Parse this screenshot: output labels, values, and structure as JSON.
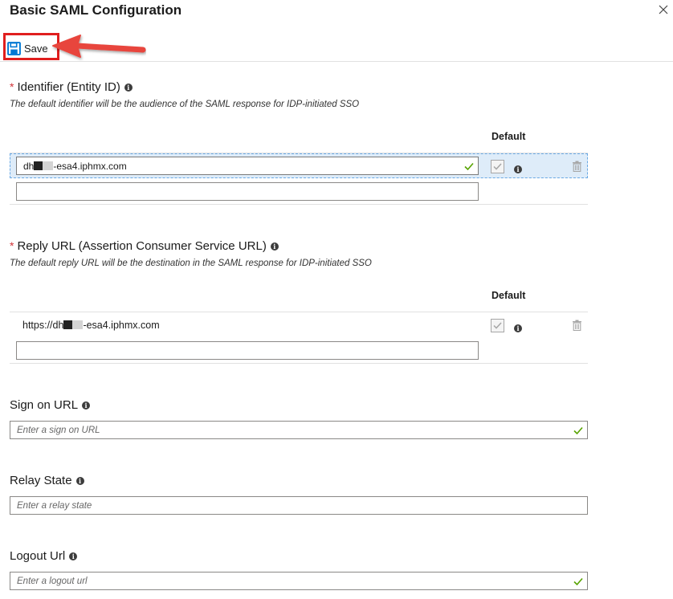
{
  "header": {
    "title": "Basic SAML Configuration",
    "close_icon": "close-icon"
  },
  "toolbar": {
    "save_label": "Save",
    "save_icon": "floppy-disk-icon"
  },
  "identifier": {
    "required_marker": "*",
    "title": "Identifier (Entity ID)",
    "description": "The default identifier will be the audience of the SAML response for IDP-initiated SSO",
    "default_header": "Default",
    "rows": [
      {
        "value_prefix": "dh",
        "value_suffix": "-esa4.iphmx.com",
        "is_default": true
      }
    ],
    "empty_value": ""
  },
  "reply_url": {
    "required_marker": "*",
    "title": "Reply URL (Assertion Consumer Service URL)",
    "description": "The default reply URL will be the destination in the SAML response for IDP-initiated SSO",
    "default_header": "Default",
    "rows": [
      {
        "value_prefix": "https://dh",
        "value_suffix": "-esa4.iphmx.com",
        "is_default": true
      }
    ],
    "empty_value": ""
  },
  "sign_on_url": {
    "title": "Sign on URL",
    "placeholder": "Enter a sign on URL"
  },
  "relay_state": {
    "title": "Relay State",
    "placeholder": "Enter a relay state"
  },
  "logout_url": {
    "title": "Logout Url",
    "placeholder": "Enter a logout url"
  },
  "colors": {
    "highlight_red": "#e01e1e",
    "required_red": "#d13438",
    "valid_green": "#57a300",
    "save_blue": "#0078d4",
    "selected_row_bg": "#deecf9"
  }
}
